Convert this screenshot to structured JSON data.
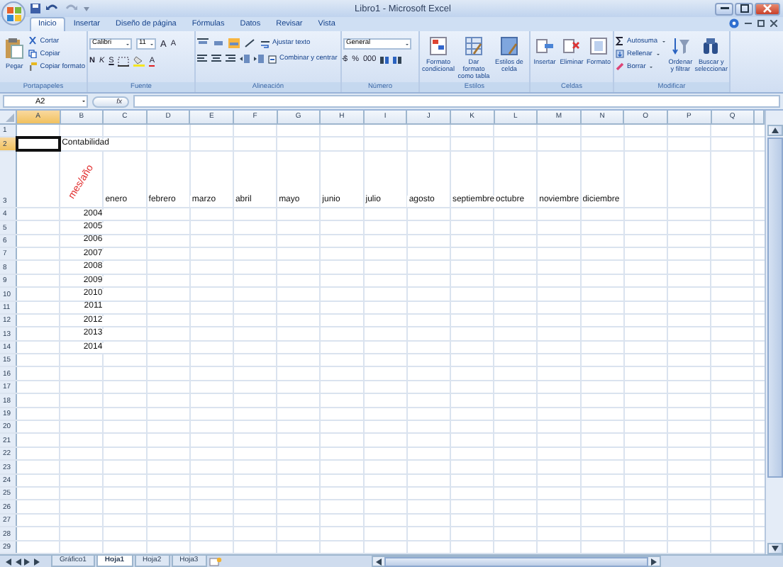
{
  "window": {
    "title": "Libro1 - Microsoft Excel"
  },
  "tabs": [
    {
      "label": "Inicio",
      "selected": true
    },
    {
      "label": "Insertar",
      "selected": false
    },
    {
      "label": "Diseño de página",
      "selected": false
    },
    {
      "label": "Fórmulas",
      "selected": false
    },
    {
      "label": "Datos",
      "selected": false
    },
    {
      "label": "Revisar",
      "selected": false
    },
    {
      "label": "Vista",
      "selected": false
    }
  ],
  "ribbon": {
    "clipboard": {
      "label": "Portapapeles",
      "paste": "Pegar",
      "cut": "Cortar",
      "copy": "Copiar",
      "format_painter": "Copiar formato"
    },
    "font": {
      "label": "Fuente",
      "font_name": "Calibri",
      "font_size": "11",
      "grow": "A",
      "shrink": "A",
      "bold": "N",
      "italic": "K",
      "underline": "S",
      "font_color": "A"
    },
    "alignment": {
      "label": "Alineación",
      "wrap_text": "Ajustar texto",
      "merge_center": "Combinar y centrar"
    },
    "number": {
      "label": "Número",
      "format": "General",
      "currency": "$",
      "percent": "%",
      "thousands": "000"
    },
    "styles": {
      "label": "Estilos",
      "conditional": "Formato condicional",
      "as_table": "Dar formato como tabla",
      "cell_styles": "Estilos de celda"
    },
    "cells": {
      "label": "Celdas",
      "insert": "Insertar",
      "delete": "Eliminar",
      "format": "Formato"
    },
    "editing": {
      "label": "Modificar",
      "autosum": "Autosuma",
      "fill": "Rellenar",
      "clear": "Borrar",
      "sort_filter": "Ordenar y filtrar",
      "find_select": "Buscar y seleccionar"
    }
  },
  "formula_bar": {
    "name_box": "A2",
    "function_label": "fx"
  },
  "sheet": {
    "columns": [
      {
        "header": "A",
        "selected": true
      },
      {
        "header": "B",
        "selected": false
      },
      {
        "header": "C",
        "selected": false
      },
      {
        "header": "D",
        "selected": false
      },
      {
        "header": "E",
        "selected": false
      },
      {
        "header": "F",
        "selected": false
      },
      {
        "header": "G",
        "selected": false
      },
      {
        "header": "H",
        "selected": false
      },
      {
        "header": "I",
        "selected": false
      },
      {
        "header": "J",
        "selected": false
      },
      {
        "header": "K",
        "selected": false
      },
      {
        "header": "L",
        "selected": false
      },
      {
        "header": "M",
        "selected": false
      },
      {
        "header": "N",
        "selected": false
      },
      {
        "header": "O",
        "selected": false
      },
      {
        "header": "P",
        "selected": false
      },
      {
        "header": "Q",
        "selected": false
      }
    ],
    "rows": [
      {
        "header": "1",
        "selected": false
      },
      {
        "header": "2",
        "selected": true,
        "cells": [
          null,
          {
            "kind": "text",
            "text": "Contabilidad"
          }
        ]
      },
      {
        "header": "3",
        "selected": false,
        "cells": [
          null,
          {
            "kind": "rotated",
            "text": "mes/año"
          },
          {
            "kind": "text",
            "text": "enero"
          },
          {
            "kind": "text",
            "text": "febrero"
          },
          {
            "kind": "text",
            "text": "marzo"
          },
          {
            "kind": "text",
            "text": "abril"
          },
          {
            "kind": "text",
            "text": "mayo"
          },
          {
            "kind": "text",
            "text": "junio"
          },
          {
            "kind": "text",
            "text": "julio"
          },
          {
            "kind": "text",
            "text": "agosto"
          },
          {
            "kind": "text",
            "text": "septiembre"
          },
          {
            "kind": "text",
            "text": "octubre"
          },
          {
            "kind": "text",
            "text": "noviembre"
          },
          {
            "kind": "text",
            "text": "diciembre"
          }
        ]
      },
      {
        "header": "4",
        "selected": false,
        "cells": [
          null,
          {
            "kind": "number",
            "text": "2004"
          }
        ]
      },
      {
        "header": "5",
        "selected": false,
        "cells": [
          null,
          {
            "kind": "number",
            "text": "2005"
          }
        ]
      },
      {
        "header": "6",
        "selected": false,
        "cells": [
          null,
          {
            "kind": "number",
            "text": "2006"
          }
        ]
      },
      {
        "header": "7",
        "selected": false,
        "cells": [
          null,
          {
            "kind": "number",
            "text": "2007"
          }
        ]
      },
      {
        "header": "8",
        "selected": false,
        "cells": [
          null,
          {
            "kind": "number",
            "text": "2008"
          }
        ]
      },
      {
        "header": "9",
        "selected": false,
        "cells": [
          null,
          {
            "kind": "number",
            "text": "2009"
          }
        ]
      },
      {
        "header": "10",
        "selected": false,
        "cells": [
          null,
          {
            "kind": "number",
            "text": "2010"
          }
        ]
      },
      {
        "header": "11",
        "selected": false,
        "cells": [
          null,
          {
            "kind": "number",
            "text": "2011"
          }
        ]
      },
      {
        "header": "12",
        "selected": false,
        "cells": [
          null,
          {
            "kind": "number",
            "text": "2012"
          }
        ]
      },
      {
        "header": "13",
        "selected": false,
        "cells": [
          null,
          {
            "kind": "number",
            "text": "2013"
          }
        ]
      },
      {
        "header": "14",
        "selected": false,
        "cells": [
          null,
          {
            "kind": "number",
            "text": "2014"
          }
        ]
      },
      {
        "header": "15",
        "selected": false
      },
      {
        "header": "16",
        "selected": false
      },
      {
        "header": "17",
        "selected": false
      },
      {
        "header": "18",
        "selected": false
      },
      {
        "header": "19",
        "selected": false
      },
      {
        "header": "20",
        "selected": false
      },
      {
        "header": "21",
        "selected": false
      },
      {
        "header": "22",
        "selected": false
      },
      {
        "header": "23",
        "selected": false
      },
      {
        "header": "24",
        "selected": false
      },
      {
        "header": "25",
        "selected": false
      },
      {
        "header": "26",
        "selected": false
      },
      {
        "header": "27",
        "selected": false
      },
      {
        "header": "28",
        "selected": false
      },
      {
        "header": "29",
        "selected": false
      }
    ]
  },
  "sheet_tabs": [
    {
      "label": "Gráfico1",
      "selected": false
    },
    {
      "label": "Hoja1",
      "selected": true
    },
    {
      "label": "Hoja2",
      "selected": false
    },
    {
      "label": "Hoja3",
      "selected": false
    }
  ]
}
